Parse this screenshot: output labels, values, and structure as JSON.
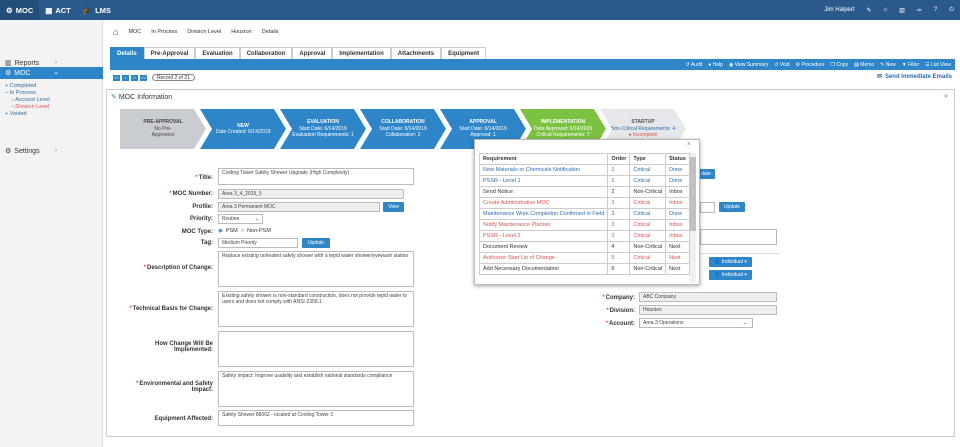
{
  "topbar": {
    "tabs": [
      {
        "label": "MOC",
        "icon": "gear-icon"
      },
      {
        "label": "ACT",
        "icon": "calendar-icon"
      },
      {
        "label": "LMS",
        "icon": "graduation-icon"
      }
    ],
    "user": "Jim Halpert"
  },
  "sidebar": {
    "items": [
      {
        "label": "Reports",
        "icon": "chart-icon"
      },
      {
        "label": "MOC",
        "icon": "gear-icon"
      },
      {
        "label": "Settings",
        "icon": "gear-icon"
      }
    ],
    "sub": [
      "Completed",
      "In Process",
      "Account Level",
      "Division Level",
      "Voided"
    ]
  },
  "breadcrumb": [
    "MOC",
    "In Process",
    "Division Level",
    "Houston",
    "Details"
  ],
  "tabs": [
    "Details",
    "Pre-Approval",
    "Evaluation",
    "Collaboration",
    "Approval",
    "Implementation",
    "Attachments",
    "Equipment"
  ],
  "toolbar": [
    "Audit",
    "Help",
    "View Summary",
    "Void",
    "Procedure",
    "Copy",
    "Memo",
    "New",
    "Filter",
    "List View"
  ],
  "record": {
    "pages": [
      "<<",
      "<",
      "»",
      ">>"
    ],
    "label": "Record 2 of 21"
  },
  "send_emails": "Send Immediate Emails",
  "panel_title": "MOC Information",
  "stages": [
    {
      "title": "PRE-APPROVAL",
      "l2": "No Pre-",
      "l3": "Approvers",
      "color": "#c9ccd1"
    },
    {
      "title": "NEW",
      "l2": "Date Created: 6/14/2019",
      "l3": "",
      "color": "#2e86c9"
    },
    {
      "title": "EVALUATION",
      "l2": "Start Date: 6/14/2019",
      "l3": "Evaluation Requirements: 1",
      "color": "#2e86c9"
    },
    {
      "title": "COLLABORATION",
      "l2": "Start Date: 6/14/2019",
      "l3": "Collaboration: 2",
      "color": "#2e86c9"
    },
    {
      "title": "APPROVAL",
      "l2": "Start Date: 6/14/2019",
      "l3": "Approval: 1",
      "color": "#2e86c9"
    },
    {
      "title": "IMPLEMENTATION",
      "l2": "Date Approved: 6/14/2019",
      "l3": "Critical Requirements: 7",
      "color": "#7cc242"
    },
    {
      "title": "STARTUP",
      "l2": "Non-Critical Requirements: 4",
      "l3": "Incomplete",
      "color": "#e6e7ea"
    }
  ],
  "form": {
    "title_label": "Title:",
    "title": "Cooling Tower Safety Shower Upgrade (High Complexity)",
    "moc_number_label": "MOC Number:",
    "moc_number": "Area 3_4_2019_5",
    "profile_label": "Profile:",
    "profile": "Area 3 Permanent MOC",
    "view": "View",
    "priority_label": "Priority:",
    "priority": "Routine",
    "moc_type_label": "MOC Type:",
    "psm": "PSM",
    "non_psm": "Non-PSM",
    "tag_label": "Tag:",
    "tag": "Medium Priority",
    "update": "Update",
    "desc_label": "Description of Change:",
    "desc": "Replace existing unheated safety shower with a tepid water shower/eyewash station",
    "tech_label": "Technical Basis for Change:",
    "tech": "Existing safety shower is non-standard construction, does not provide tepid water to users and does not comply with ANSI Z358.1",
    "impl_label": "How Change Will Be Implemented:",
    "impl": "",
    "env_label": "Environmental and Safety Impact:",
    "env": "Safety impact:  Improve usability and  establish national standards compliance",
    "equip_label": "Equipment Affected:",
    "equip": "Safety Shower 88002 - located at Cooling Tower 3",
    "company_label": "Company:",
    "company": "ABC Company",
    "division_label": "Division:",
    "division": "Houston",
    "account_label": "Account:",
    "account": "Area 3 Operations",
    "individual": "Individual",
    "update2": "Update",
    "date_btn": "date"
  },
  "popup": {
    "headers": [
      "Requirement",
      "Order",
      "Type",
      "Status"
    ],
    "rows": [
      [
        "New Materials or Chemicals Notification",
        "1",
        "Critical",
        "Done",
        "blue"
      ],
      [
        "PSSR - Level 1",
        "1",
        "Critical",
        "Done",
        "blue"
      ],
      [
        "Send Notice",
        "2",
        "Non-Critical",
        "Inbox",
        ""
      ],
      [
        "Create Administrative MOC",
        "3",
        "Critical",
        "Inbox",
        "redt"
      ],
      [
        "Maintenance Work Completion Confirmed in Field",
        "3",
        "Critical",
        "Done",
        "blue"
      ],
      [
        "Notify Maintenance Planner",
        "3",
        "Critical",
        "Inbox",
        "redt"
      ],
      [
        "PSSR - Level 2",
        "3",
        "Critical",
        "Inbox",
        "redt"
      ],
      [
        "Document Review",
        "4",
        "Non-Critical",
        "Next",
        ""
      ],
      [
        "Authorize Start Up of Change",
        "5",
        "Critical",
        "Next",
        "redt"
      ],
      [
        "Add Necessary Documentation",
        "6",
        "Non-Critical",
        "Next",
        ""
      ]
    ]
  }
}
